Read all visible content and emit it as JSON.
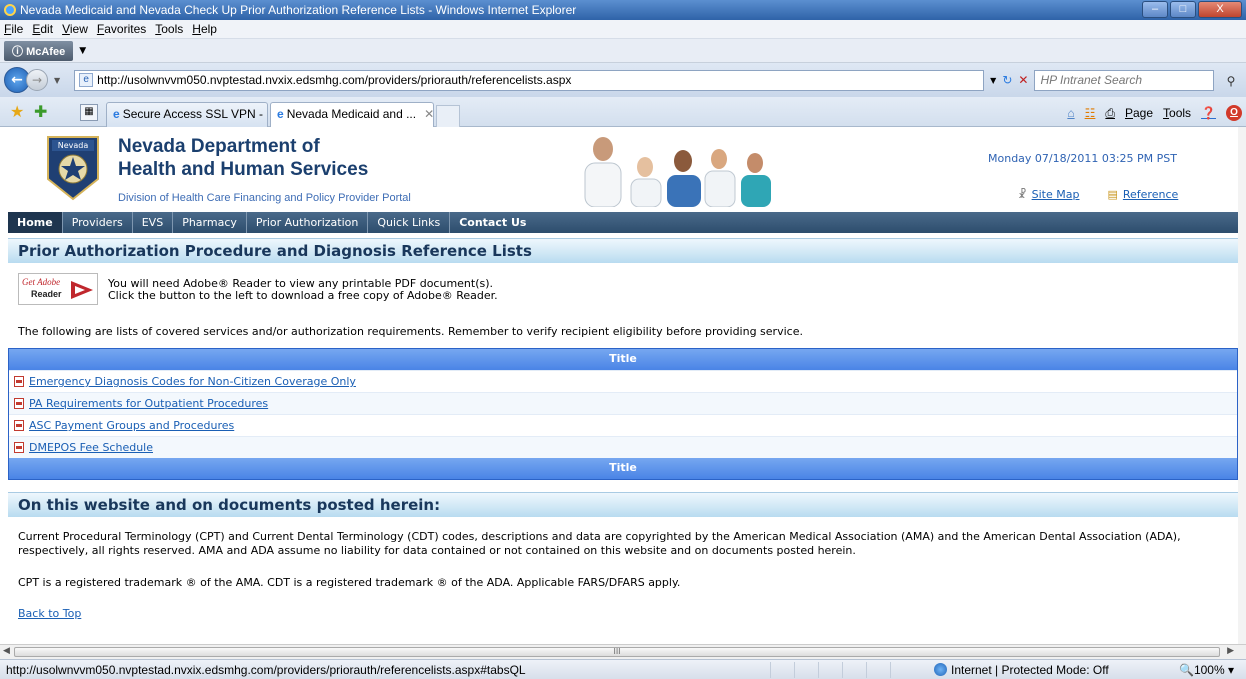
{
  "window": {
    "title": "Nevada Medicaid and Nevada Check Up Prior Authorization Reference Lists - Windows Internet Explorer",
    "min": "–",
    "max": "□",
    "close": "X"
  },
  "menu": [
    "File",
    "Edit",
    "View",
    "Favorites",
    "Tools",
    "Help"
  ],
  "mcafee": "McAfee",
  "address": {
    "url": "http://usolwnvvm050.nvptestad.nvxix.edsmhg.com/providers/priorauth/referencelists.aspx",
    "search_placeholder": "HP Intranet Search"
  },
  "tabs": [
    {
      "label": "Secure Access SSL VPN - H..."
    },
    {
      "label": "Nevada Medicaid and ..."
    }
  ],
  "commands": [
    "Page",
    "Tools"
  ],
  "header": {
    "org_line1": "Nevada Department of",
    "org_line2": "Health and Human Services",
    "org_sub": "Division of Health Care Financing and Policy Provider Portal",
    "seal_text": "Nevada",
    "datetime": "Monday 07/18/2011 03:25 PM PST",
    "sitemap": "Site Map",
    "reference": "Reference"
  },
  "nav": [
    "Home",
    "Providers",
    "EVS",
    "Pharmacy",
    "Prior Authorization",
    "Quick Links",
    "Contact Us"
  ],
  "main": {
    "heading": "Prior Authorization Procedure and Diagnosis Reference Lists",
    "adobe_get": "Get Adobe",
    "adobe_reader": "Reader",
    "adobe_line1": "You will need Adobe® Reader to view any printable PDF document(s).",
    "adobe_line2": "Click the button to the left to download a free copy of Adobe® Reader.",
    "intro": "The following are lists of covered services and/or authorization requirements. Remember to verify recipient eligibility before providing service.",
    "table_header": "Title",
    "table_footer": "Title",
    "documents": [
      "Emergency Diagnosis Codes for Non-Citizen Coverage Only",
      "PA Requirements for Outpatient Procedures",
      "ASC Payment Groups and Procedures",
      "DMEPOS Fee Schedule"
    ]
  },
  "notice": {
    "heading": "On this website and on documents posted herein:",
    "copyright": "Current Procedural Terminology (CPT) and Current Dental Terminology (CDT) codes, descriptions and data are copyrighted by the American Medical Association (AMA) and the American Dental Association (ADA), respectively, all rights reserved. AMA and ADA assume no liability for data contained or not contained on this website and on documents posted herein.",
    "trademark": "CPT is a registered trademark ® of the AMA. CDT is a registered trademark ® of the ADA. Applicable FARS/DFARS apply.",
    "back_to_top": "Back to Top"
  },
  "status": {
    "url": "http://usolwnvvm050.nvptestad.nvxix.edsmhg.com/providers/priorauth/referencelists.aspx#tabsQL",
    "zone": "Internet | Protected Mode: Off",
    "zoom": "100%"
  },
  "colors": {
    "nav_bg": "#2d4d6d",
    "grid_header": "#4a84e6",
    "link": "#1a5fb4",
    "heading_text": "#19375b"
  }
}
